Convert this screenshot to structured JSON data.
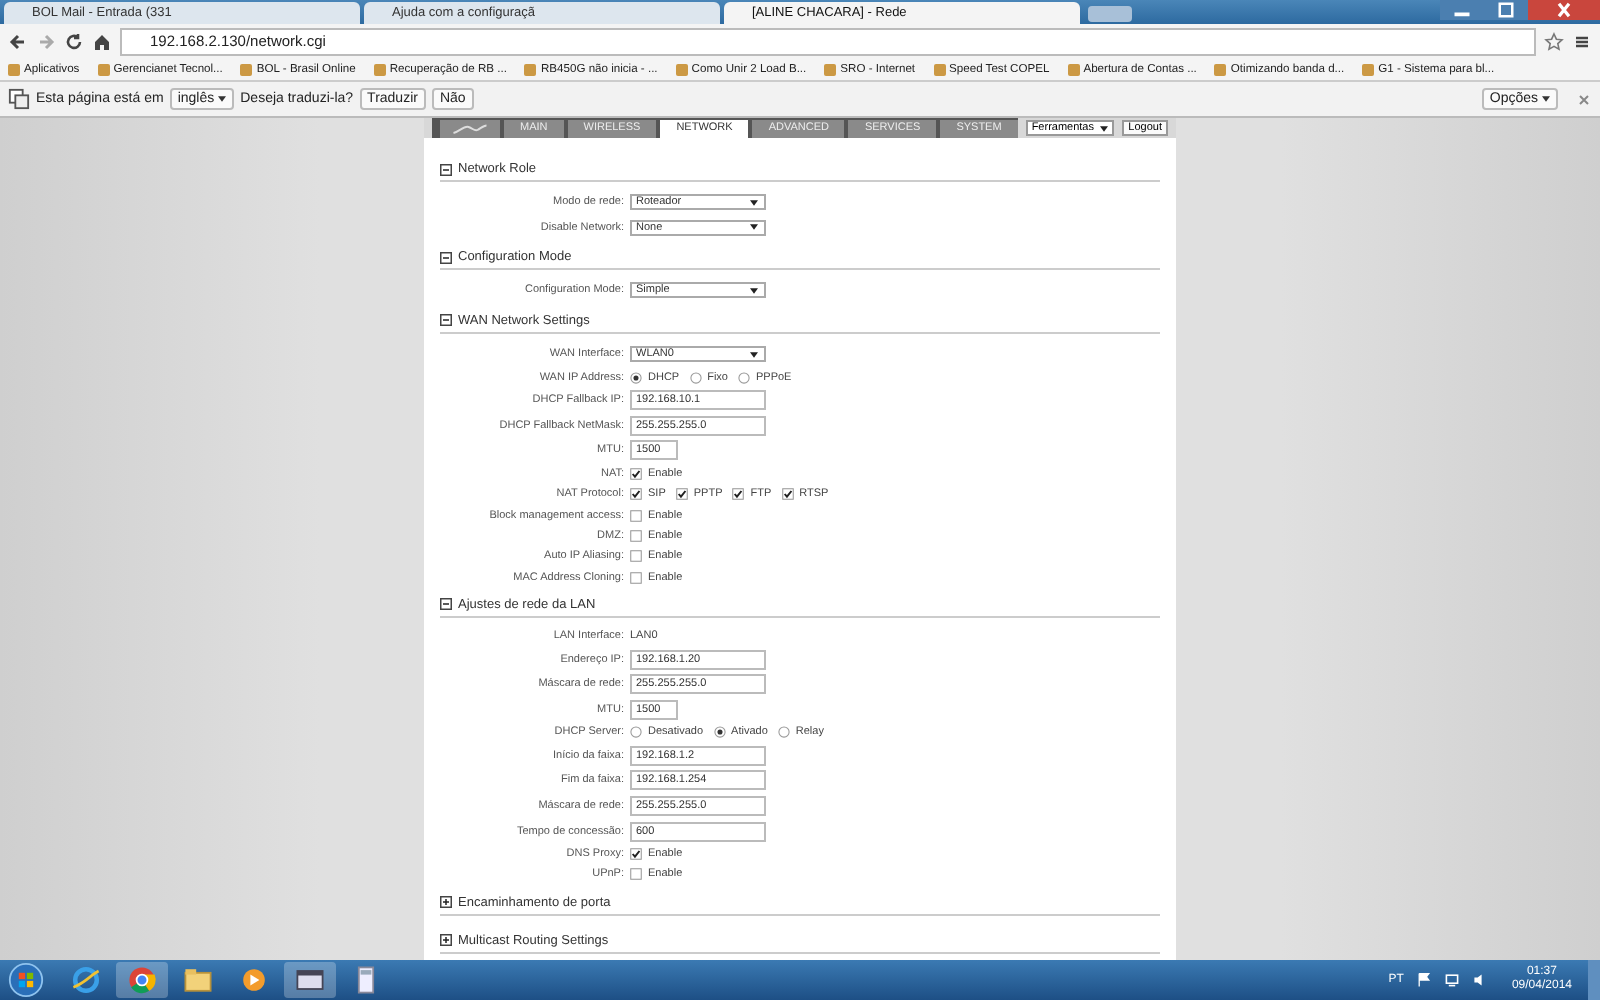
{
  "browser": {
    "tabs": [
      {
        "title": "BOL Mail - Entrada (331",
        "selected": false
      },
      {
        "title": "Ajuda com a configuraçã",
        "selected": false
      },
      {
        "title": "[ALINE CHACARA] - Rede",
        "selected": true
      }
    ],
    "address": "192.168.2.130/network.cgi",
    "bookmarks": [
      "Aplicativos",
      "Gerencianet Tecnol...",
      "BOL - Brasil Online",
      "Recuperação de RB ...",
      "RB450G não inicia - ...",
      "Como Unir 2 Load B...",
      "SRO - Internet",
      "Speed Test COPEL",
      "Abertura de Contas ...",
      "Otimizando banda d...",
      "G1 - Sistema para bl..."
    ],
    "translate": {
      "prefix": "Esta página está em",
      "language": "inglês",
      "question": "Deseja traduzi-la?",
      "translate_button": "Traduzir",
      "no_button": "Não",
      "options": "Opções"
    }
  },
  "router": {
    "nav_tabs": [
      {
        "label": "MAIN",
        "selected": false
      },
      {
        "label": "WIRELESS",
        "selected": false
      },
      {
        "label": "NETWORK",
        "selected": true
      },
      {
        "label": "ADVANCED",
        "selected": false
      },
      {
        "label": "SERVICES",
        "selected": false
      },
      {
        "label": "SYSTEM",
        "selected": false
      }
    ],
    "tools_select": "Ferramentas",
    "logout": "Logout",
    "sections": [
      {
        "title": "Network Role",
        "expanded": true,
        "rows": [
          {
            "kind": "select",
            "label": "Modo de rede:",
            "value": "Roteador"
          },
          {
            "kind": "select",
            "label": "Disable Network:",
            "value": "None"
          }
        ]
      },
      {
        "title": "Configuration Mode",
        "expanded": true,
        "rows": [
          {
            "kind": "select",
            "label": "Configuration Mode:",
            "value": "Simple"
          }
        ]
      },
      {
        "title": "WAN Network Settings",
        "expanded": true,
        "rows": [
          {
            "kind": "select",
            "label": "WAN Interface:",
            "value": "WLAN0"
          },
          {
            "kind": "radio",
            "label": "WAN IP Address:",
            "options": [
              {
                "label": "DHCP",
                "selected": true
              },
              {
                "label": "Fixo",
                "selected": false
              },
              {
                "label": "PPPoE",
                "selected": false
              }
            ]
          },
          {
            "kind": "text",
            "label": "DHCP Fallback IP:",
            "value": "192.168.10.1"
          },
          {
            "kind": "text",
            "label": "DHCP Fallback NetMask:",
            "value": "255.255.255.0"
          },
          {
            "kind": "short_text",
            "label": "MTU:",
            "value": "1500"
          },
          {
            "kind": "checks",
            "label": "NAT:",
            "options": [
              {
                "label": "Enable",
                "checked": true
              }
            ]
          },
          {
            "kind": "checks",
            "label": "NAT Protocol:",
            "options": [
              {
                "label": "SIP",
                "checked": true
              },
              {
                "label": "PPTP",
                "checked": true
              },
              {
                "label": "FTP",
                "checked": true
              },
              {
                "label": "RTSP",
                "checked": true
              }
            ]
          },
          {
            "kind": "checks",
            "label": "Block management access:",
            "options": [
              {
                "label": "Enable",
                "checked": false
              }
            ]
          },
          {
            "kind": "checks",
            "label": "DMZ:",
            "options": [
              {
                "label": "Enable",
                "checked": false
              }
            ]
          },
          {
            "kind": "checks",
            "label": "Auto IP Aliasing:",
            "options": [
              {
                "label": "Enable",
                "checked": false
              }
            ]
          },
          {
            "kind": "checks",
            "label": "MAC Address Cloning:",
            "options": [
              {
                "label": "Enable",
                "checked": false
              }
            ]
          }
        ]
      },
      {
        "title": "Ajustes de rede da LAN",
        "expanded": true,
        "rows": [
          {
            "kind": "static",
            "label": "LAN Interface:",
            "value": "LAN0"
          },
          {
            "kind": "text",
            "label": "Endereço IP:",
            "value": "192.168.1.20"
          },
          {
            "kind": "text",
            "label": "Máscara de rede:",
            "value": "255.255.255.0"
          },
          {
            "kind": "short_text",
            "label": "MTU:",
            "value": "1500"
          },
          {
            "kind": "radio",
            "label": "DHCP Server:",
            "options": [
              {
                "label": "Desativado",
                "selected": false
              },
              {
                "label": "Ativado",
                "selected": true
              },
              {
                "label": "Relay",
                "selected": false
              }
            ]
          },
          {
            "kind": "text",
            "label": "Início da faixa:",
            "value": "192.168.1.2"
          },
          {
            "kind": "text",
            "label": "Fim da faixa:",
            "value": "192.168.1.254"
          },
          {
            "kind": "text",
            "label": "Máscara de rede:",
            "value": "255.255.255.0"
          },
          {
            "kind": "text",
            "label": "Tempo de concessão:",
            "value": "600"
          },
          {
            "kind": "checks",
            "label": "DNS Proxy:",
            "options": [
              {
                "label": "Enable",
                "checked": true
              }
            ]
          },
          {
            "kind": "checks",
            "label": "UPnP:",
            "options": [
              {
                "label": "Enable",
                "checked": false
              }
            ]
          }
        ]
      },
      {
        "title": "Encaminhamento de porta",
        "expanded": false
      },
      {
        "title": "Multicast Routing Settings",
        "expanded": false
      }
    ]
  },
  "taskbar": {
    "language": "PT",
    "time": "01:37",
    "date": "09/04/2014"
  }
}
